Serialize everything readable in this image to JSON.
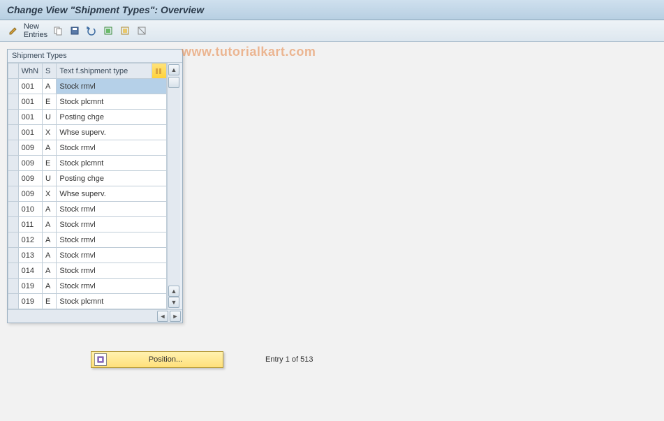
{
  "title": "Change View \"Shipment Types\": Overview",
  "watermark": "www.tutorialkart.com",
  "toolbar": {
    "new_entries_label": "New Entries"
  },
  "panel": {
    "title": "Shipment Types",
    "columns": {
      "sel": "",
      "whn": "WhN",
      "s": "S",
      "text": "Text f.shipment type"
    },
    "rows": [
      {
        "whn": "001",
        "s": "A",
        "text": "Stock rmvl",
        "selected": true
      },
      {
        "whn": "001",
        "s": "E",
        "text": "Stock plcmnt"
      },
      {
        "whn": "001",
        "s": "U",
        "text": "Posting chge"
      },
      {
        "whn": "001",
        "s": "X",
        "text": "Whse superv."
      },
      {
        "whn": "009",
        "s": "A",
        "text": "Stock rmvl"
      },
      {
        "whn": "009",
        "s": "E",
        "text": "Stock plcmnt"
      },
      {
        "whn": "009",
        "s": "U",
        "text": "Posting chge"
      },
      {
        "whn": "009",
        "s": "X",
        "text": "Whse superv."
      },
      {
        "whn": "010",
        "s": "A",
        "text": "Stock rmvl"
      },
      {
        "whn": "011",
        "s": "A",
        "text": "Stock rmvl"
      },
      {
        "whn": "012",
        "s": "A",
        "text": "Stock rmvl"
      },
      {
        "whn": "013",
        "s": "A",
        "text": "Stock rmvl"
      },
      {
        "whn": "014",
        "s": "A",
        "text": "Stock rmvl"
      },
      {
        "whn": "019",
        "s": "A",
        "text": "Stock rmvl"
      },
      {
        "whn": "019",
        "s": "E",
        "text": "Stock plcmnt"
      }
    ]
  },
  "footer": {
    "position_label": "Position...",
    "entry_text": "Entry 1 of 513"
  }
}
